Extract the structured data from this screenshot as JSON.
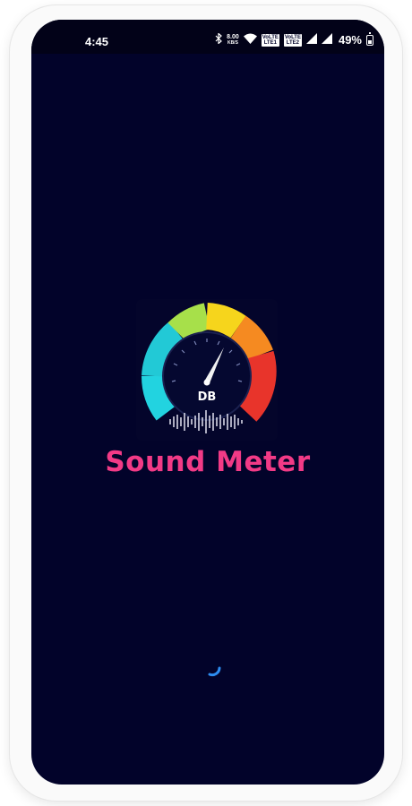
{
  "status_bar": {
    "time": "4:45",
    "net_speed_value": "8.00",
    "net_speed_unit": "KB/S",
    "volte1": [
      "VoLTE",
      "LTE1"
    ],
    "volte2": [
      "VoLTE",
      "LTE2"
    ],
    "battery_percent": "49%",
    "battery_level": 0.49,
    "icons": [
      "bluetooth-icon",
      "wifi-icon",
      "signal-icon",
      "signal-icon",
      "battery-icon"
    ]
  },
  "splash": {
    "logo_label": "DB",
    "app_name": "Sound Meter",
    "gauge_colors": [
      "#22d3e0",
      "#a7e04a",
      "#f6d51c",
      "#f58a21",
      "#e8342b"
    ],
    "title_color": "#f23a86",
    "loading_indicator": "spinner-icon"
  },
  "colors": {
    "background": "#02032a",
    "spinner": "#2d8cf0"
  }
}
